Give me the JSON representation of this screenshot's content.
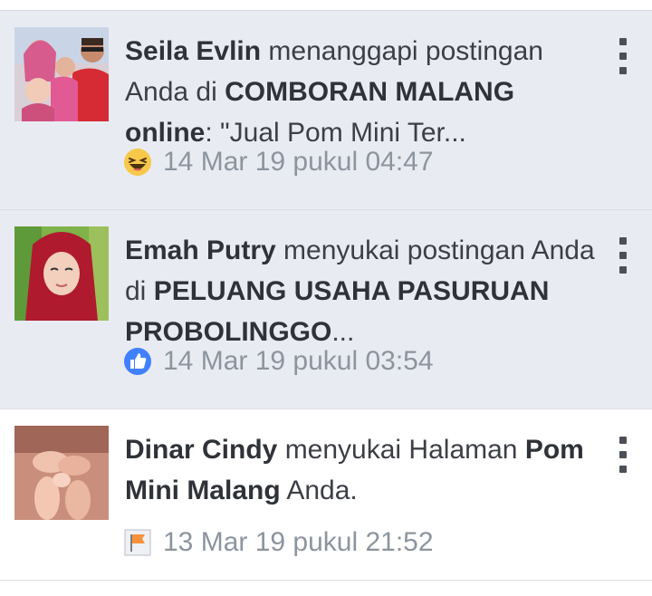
{
  "notifications": [
    {
      "actor": "Seila Evlin",
      "action": " menanggapi postingan Anda di ",
      "target": "COMBORAN MALANG online",
      "suffix": ": \"Jual Pom Mini Ter...",
      "time": "14 Mar 19 pukul 04:47",
      "reaction_icon": "haha-emoji-icon",
      "unread": true
    },
    {
      "actor": "Emah Putry",
      "action": " menyukai postingan Anda di ",
      "target": "PELUANG USAHA PASURUAN PROBOLINGGO",
      "suffix": "...",
      "time": "14 Mar 19 pukul 03:54",
      "reaction_icon": "like-thumb-icon",
      "unread": true
    },
    {
      "actor": "Dinar Cindy",
      "action": " menyukai Halaman ",
      "target": "Pom Mini Malang",
      "suffix": " Anda.",
      "time": "13 Mar 19 pukul 21:52",
      "reaction_icon": "page-flag-icon",
      "unread": false
    }
  ],
  "colors": {
    "unread_bg": "#e9ebf3",
    "read_bg": "#ffffff",
    "meta_text": "#8d949e",
    "like_blue": "#4080ff"
  }
}
